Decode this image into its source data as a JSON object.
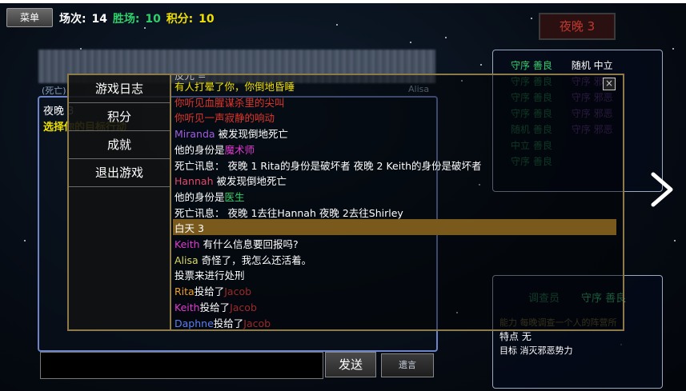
{
  "top": {
    "menu_label": "菜单",
    "games_label": "场次:",
    "games": "14",
    "wins_label": "胜场:",
    "wins": "10",
    "score_label": "积分:",
    "score": "10",
    "phase_badge": "夜晚 3"
  },
  "background": {
    "left_label": "(死亡)",
    "right_label": "Alisa",
    "info_title": "夜晚 3",
    "info_prompt": "选择你的目标行动"
  },
  "roles": [
    {
      "a": "守序 善良",
      "b": "随机 中立"
    },
    {
      "a": "守序 善良",
      "b": "守序 邪恶"
    },
    {
      "a": "守序 善良",
      "b": "守序 邪恶"
    },
    {
      "a": "守序 善良",
      "b": "守序 邪恶"
    },
    {
      "a": "随机 善良",
      "b": "守序 邪恶"
    },
    {
      "a": "中立 善良",
      "b": ""
    },
    {
      "a": "守序 善良",
      "b": ""
    }
  ],
  "detail": {
    "role_name": "调查员",
    "role_align": "守序 善良",
    "ability": "能力 每晚调查一个人的阵营所",
    "trait": "特点 无",
    "goal": "目标 消灭邪恶势力"
  },
  "chat": {
    "input_value": "",
    "send_label": "发送",
    "will_label": "遗言"
  },
  "menu": {
    "items": [
      "游戏日志",
      "积分",
      "成就",
      "退出游戏"
    ]
  },
  "log": {
    "partial_top": "反光 =",
    "lines": [
      {
        "segments": [
          {
            "t": "有人打晕了你，你倒地昏睡",
            "c": "yellow"
          }
        ]
      },
      {
        "segments": [
          {
            "t": "你听见血腥谋杀里的尖叫",
            "c": "red"
          }
        ]
      },
      {
        "segments": [
          {
            "t": "你听见一声寂静的响动",
            "c": "red"
          }
        ]
      },
      {
        "segments": [
          {
            "t": "Miranda",
            "c": "purple"
          },
          {
            "t": " 被发现倒地死亡",
            "c": "white"
          }
        ]
      },
      {
        "segments": [
          {
            "t": "他的身份是",
            "c": "white"
          },
          {
            "t": "魔术师",
            "c": "mag"
          }
        ]
      },
      {
        "segments": [
          {
            "t": "死亡讯息： 夜晚 1 Rita的身份是破坏者  夜晚 2 Keith的身份是破坏者",
            "c": "white"
          }
        ]
      },
      {
        "segments": [
          {
            "t": "Hannah",
            "c": "pink"
          },
          {
            "t": " 被发现倒地死亡",
            "c": "white"
          }
        ]
      },
      {
        "segments": [
          {
            "t": "他的身份是",
            "c": "white"
          },
          {
            "t": "医生",
            "c": "green"
          }
        ]
      },
      {
        "segments": [
          {
            "t": "死亡讯息： 夜晚 1去往Hannah  夜晚 2去往Shirley",
            "c": "white"
          }
        ]
      },
      {
        "segments": [
          {
            "t": "白天 3",
            "c": "white"
          }
        ],
        "highlight": true
      },
      {
        "segments": [
          {
            "t": "Keith",
            "c": "mag"
          },
          {
            "t": " 有什么信息要回报吗?",
            "c": "white"
          }
        ]
      },
      {
        "segments": [
          {
            "t": "Alisa",
            "c": "olive"
          },
          {
            "t": " 奇怪了，我怎么还活着。",
            "c": "white"
          }
        ]
      },
      {
        "segments": [
          {
            "t": "投票来进行处刑",
            "c": "white"
          }
        ]
      },
      {
        "segments": [
          {
            "t": "Rita",
            "c": "orange"
          },
          {
            "t": "投给了",
            "c": "white"
          },
          {
            "t": "Jacob",
            "c": "darkred"
          }
        ]
      },
      {
        "segments": [
          {
            "t": "Keith",
            "c": "mag"
          },
          {
            "t": "投给了",
            "c": "white"
          },
          {
            "t": "Jacob",
            "c": "darkred"
          }
        ]
      },
      {
        "segments": [
          {
            "t": "Daphne",
            "c": "blue"
          },
          {
            "t": "投给了",
            "c": "white"
          },
          {
            "t": "Jacob",
            "c": "darkred"
          }
        ]
      }
    ]
  },
  "colors": {
    "accent_gold": "#8c7a4a",
    "highlight": "#7a5a1c",
    "good": "#2fd06b",
    "evil": "#a05ce0",
    "night": "#c0382f"
  }
}
